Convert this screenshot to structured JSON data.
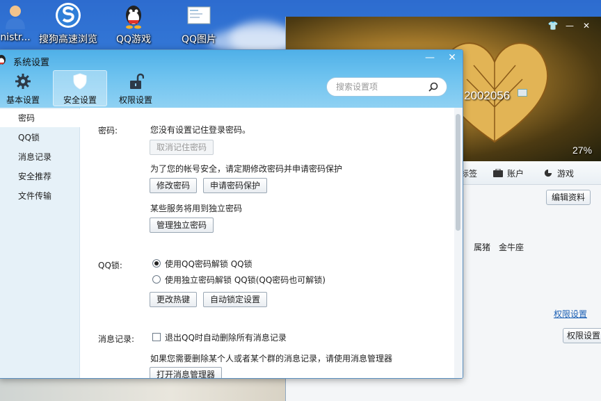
{
  "desktop": {
    "icons": [
      {
        "label": "nistr...",
        "icon": "admin-user-icon"
      },
      {
        "label": "搜狗高速浏览",
        "icon": "sogou-browser-icon"
      },
      {
        "label": "QQ游戏",
        "icon": "qq-game-icon"
      },
      {
        "label": "QQ图片",
        "icon": "qq-image-icon"
      }
    ]
  },
  "qq_panel": {
    "number": "2002056",
    "percent": "27%",
    "tabs": [
      {
        "label": "标签",
        "icon": "tag-icon"
      },
      {
        "label": "账户",
        "icon": "wallet-icon"
      },
      {
        "label": "游戏",
        "icon": "game-icon"
      }
    ],
    "edit_button": "编辑资料",
    "zodiac": [
      "属猪",
      "金牛座"
    ],
    "permission_link": "权限设置",
    "permission_button": "权限设置"
  },
  "window": {
    "title": "系统设置",
    "minimize": "—",
    "close": "✕",
    "nav": [
      {
        "label": "基本设置",
        "icon": "gear-icon",
        "active": false
      },
      {
        "label": "安全设置",
        "icon": "shield-icon",
        "active": true
      },
      {
        "label": "权限设置",
        "icon": "unlock-icon",
        "active": false
      }
    ],
    "search_placeholder": "搜索设置项"
  },
  "sidebar": {
    "items": [
      {
        "label": "密码",
        "active": true
      },
      {
        "label": "QQ锁",
        "active": false
      },
      {
        "label": "消息记录",
        "active": false
      },
      {
        "label": "安全推荐",
        "active": false
      },
      {
        "label": "文件传输",
        "active": false
      }
    ]
  },
  "content": {
    "password": {
      "label": "密码:",
      "status": "您没有设置记住登录密码。",
      "cancel_remember": "取消记住密码",
      "tip": "为了您的帐号安全，请定期修改密码并申请密码保护",
      "change_password": "修改密码",
      "apply_protect": "申请密码保护",
      "independent_tip": "某些服务将用到独立密码",
      "manage_independent": "管理独立密码"
    },
    "qqlock": {
      "label": "QQ锁:",
      "option1": "使用QQ密码解锁 QQ锁",
      "option2": "使用独立密码解锁 QQ锁(QQ密码也可解锁)",
      "selected": 1,
      "hotkey": "更改热键",
      "auto_lock": "自动锁定设置"
    },
    "messages": {
      "label": "消息记录:",
      "auto_delete": "退出QQ时自动删除所有消息记录",
      "auto_delete_checked": false,
      "tip": "如果您需要删除某个人或者某个群的消息记录，请使用消息管理器",
      "open_manager": "打开消息管理器"
    }
  },
  "colors": {
    "header_blue": "#4fb0e8",
    "sidebar_bg": "#e6f1f8",
    "link_blue": "#1a5fb4"
  }
}
